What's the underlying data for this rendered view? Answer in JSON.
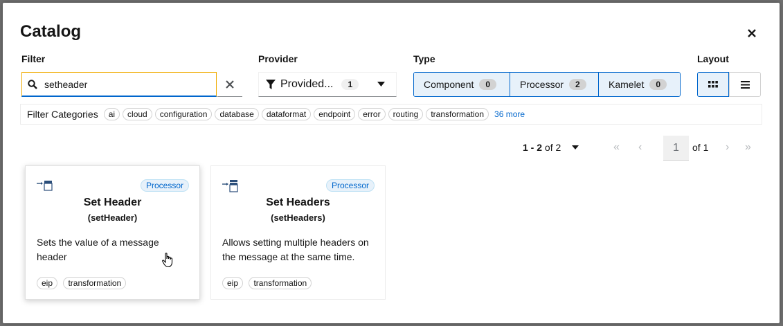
{
  "modal": {
    "title": "Catalog",
    "close_icon": "close-icon"
  },
  "filter": {
    "label": "Filter",
    "value": "setheader",
    "search_icon": "search-icon",
    "clear_icon": "clear-icon"
  },
  "provider": {
    "label": "Provider",
    "value": "Provided...",
    "count": "1",
    "filter_icon": "filter-icon"
  },
  "type": {
    "label": "Type",
    "options": [
      {
        "label": "Component",
        "count": "0"
      },
      {
        "label": "Processor",
        "count": "2"
      },
      {
        "label": "Kamelet",
        "count": "0"
      }
    ]
  },
  "layout": {
    "label": "Layout",
    "grid_icon": "grid-icon",
    "list_icon": "list-icon"
  },
  "categories": {
    "title": "Filter Categories",
    "items": [
      "ai",
      "cloud",
      "configuration",
      "database",
      "dataformat",
      "endpoint",
      "error",
      "routing",
      "transformation"
    ],
    "more": "36 more"
  },
  "pagination": {
    "range": "1 - 2",
    "of_total": "of 2",
    "page": "1",
    "of_pages": "of 1"
  },
  "cards": [
    {
      "tag": "Processor",
      "title": "Set Header",
      "subtitle": "(setHeader)",
      "description": "Sets the value of a message header",
      "tags": [
        "eip",
        "transformation"
      ]
    },
    {
      "tag": "Processor",
      "title": "Set Headers",
      "subtitle": "(setHeaders)",
      "description": "Allows setting multiple headers on the message at the same time.",
      "tags": [
        "eip",
        "transformation"
      ]
    }
  ],
  "colors": {
    "accent": "#0066cc",
    "focus": "#f0ab00",
    "toggle_selected_bg": "#e7f1fa"
  }
}
